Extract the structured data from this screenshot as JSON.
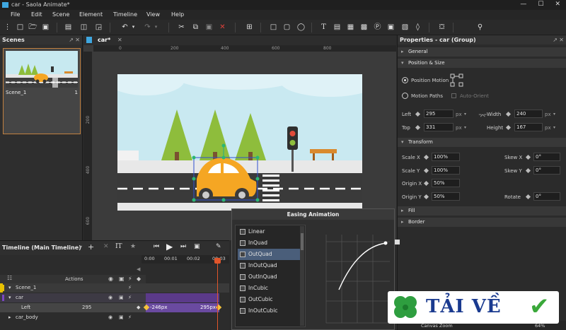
{
  "window": {
    "title": "car - Saola Animate*",
    "controls": [
      "—",
      "☐",
      "✕"
    ]
  },
  "menu": [
    "File",
    "Edit",
    "Scene",
    "Element",
    "Timeline",
    "View",
    "Help"
  ],
  "scenes_panel": {
    "title": "Scenes",
    "scene_name": "Scene_1",
    "scene_number": "1"
  },
  "canvas": {
    "tab": "car*",
    "ruler_h": [
      "0",
      "200",
      "400",
      "600",
      "800"
    ],
    "ruler_v": [
      "200",
      "400",
      "600"
    ]
  },
  "properties": {
    "title": "Properties - car (Group)",
    "sections": {
      "general": "General",
      "position_size": "Position & Size",
      "transform": "Transform",
      "fill": "Fill",
      "border": "Border"
    },
    "position_motion": "Position Motion",
    "motion_paths": "Motion Paths",
    "auto_orient": "Auto-Orient",
    "left_label": "Left",
    "left_value": "295",
    "top_label": "Top",
    "top_value": "331",
    "width_label": "Width",
    "width_value": "240",
    "height_label": "Height",
    "height_value": "167",
    "unit": "px",
    "scale_x_label": "Scale X",
    "scale_x_value": "100%",
    "scale_y_label": "Scale Y",
    "scale_y_value": "100%",
    "origin_x_label": "Origin X",
    "origin_x_value": "50%",
    "origin_y_label": "Origin Y",
    "origin_y_value": "50%",
    "skew_x_label": "Skew X",
    "skew_x_value": "0°",
    "skew_y_label": "Skew Y",
    "skew_y_value": "0°",
    "rotate_label": "Rotate",
    "rotate_value": "0°",
    "canvas_zoom_label": "Canvas Zoom",
    "canvas_zoom_value": "64%"
  },
  "timeline": {
    "title": "Timeline (Main Timeline)",
    "actions_label": "Actions",
    "times": [
      "0:00",
      "00:01",
      "00:02",
      "00:03"
    ],
    "rows": {
      "scene": "Scene_1",
      "car": "car",
      "left": "Left",
      "left_value": "295",
      "car_body": "car_body"
    },
    "kf_start": "-246px",
    "kf_end": "295px"
  },
  "easing": {
    "title": "Easing Animation",
    "items": [
      "Linear",
      "InQuad",
      "OutQuad",
      "InOutQuad",
      "OutInQuad",
      "InCubic",
      "OutCubic",
      "InOutCubic"
    ],
    "selected": "OutQuad"
  },
  "watermark": {
    "text": "TẢI VỀ"
  },
  "colors": {
    "accent": "#3fa7e0",
    "selected_easing": "#4a5e7a",
    "car": "#f5a623",
    "tree": "#8ebd3c",
    "keyframe_bar": "#5b3a8a",
    "playhead": "#e0552b",
    "watermark_blue": "#1a3a8f",
    "watermark_green": "#3aa83a"
  }
}
